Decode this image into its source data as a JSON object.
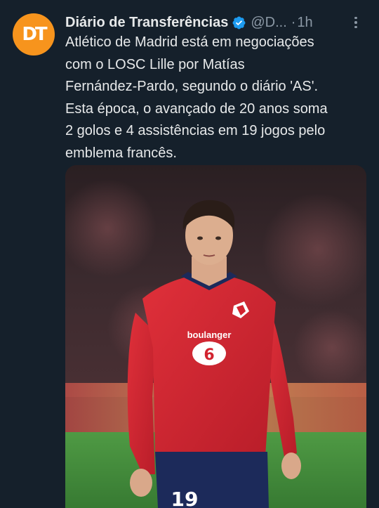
{
  "tweet": {
    "avatar": {
      "initials": "DT",
      "color": "#f7941d"
    },
    "author": {
      "display_name": "Diário de Transferências",
      "verified_icon": "verified-badge-icon",
      "handle": "@D...",
      "separator": "·",
      "time": "1h"
    },
    "more_icon": "more-options-icon",
    "text_lines": [
      "Atlético de Madrid está em negociações",
      "com o LOSC Lille por Matías",
      "Fernández-Pardo, segundo o diário 'AS'.",
      "Esta época, o avançado de 20 anos soma",
      "2 golos e 4 assistências em 19 jogos pelo",
      "emblema francês."
    ],
    "media": {
      "description_icon": "player-photo",
      "shirt_sponsor": "boulanger",
      "shirt_number": "19",
      "colors": {
        "shirt": "#d2232f",
        "shorts": "#1c2a5a",
        "pitch": "#3f8a3a"
      }
    }
  },
  "theme": {
    "background": "#15202b",
    "text": "#e7e9ea",
    "secondary": "#8b98a5",
    "verified": "#1d9bf0"
  }
}
